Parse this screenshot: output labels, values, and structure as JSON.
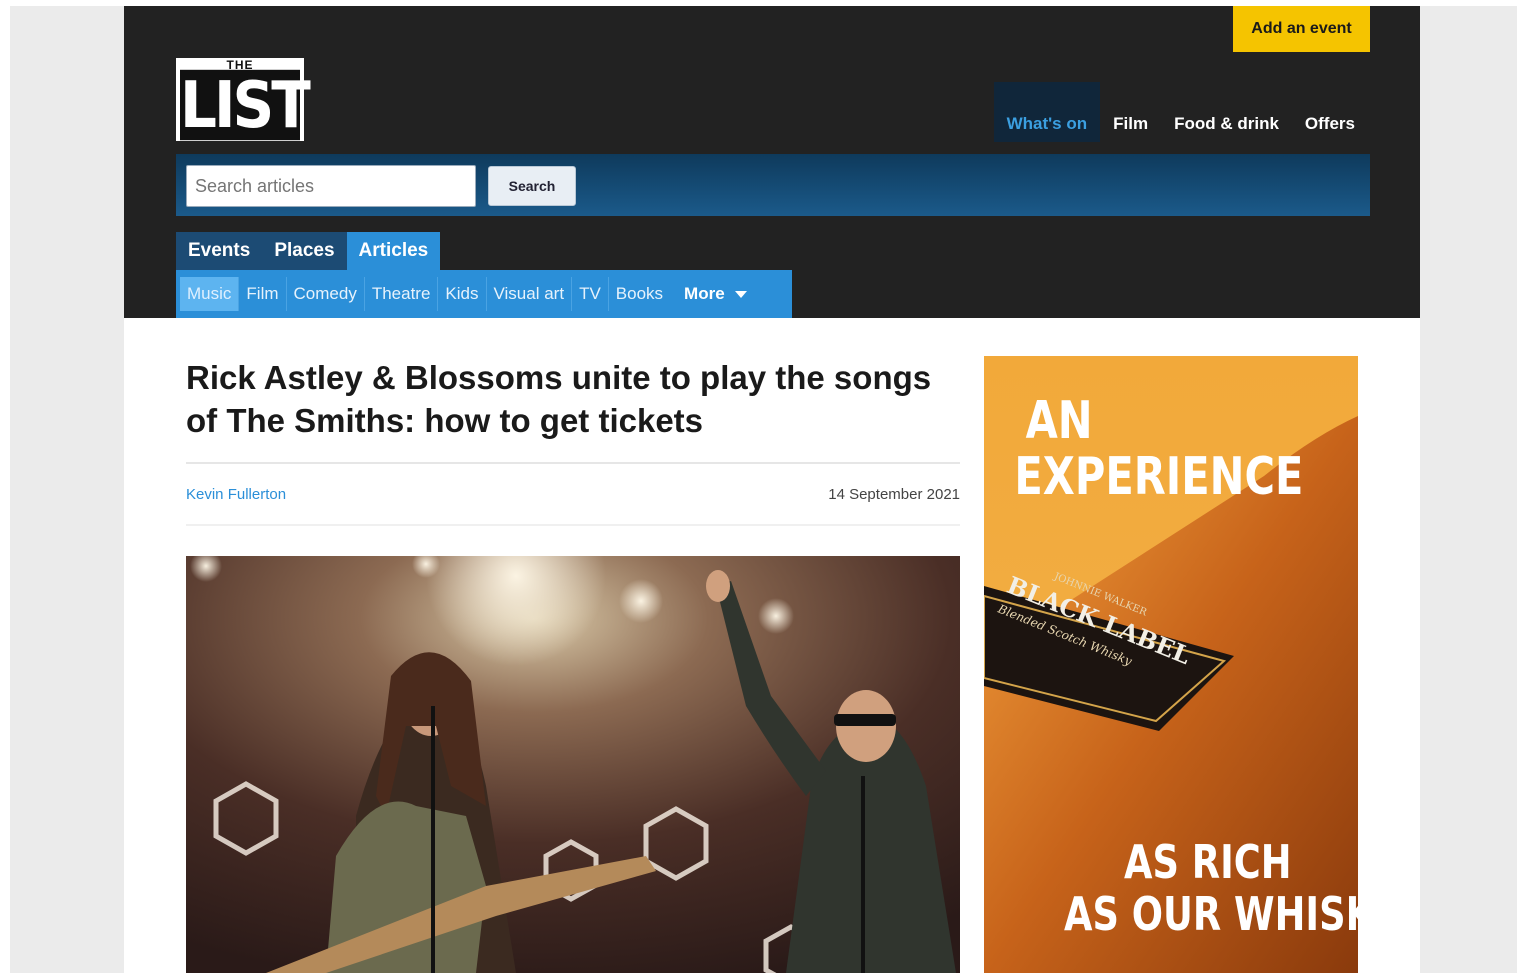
{
  "header": {
    "add_event": "Add an event",
    "logo_top": "THE",
    "logo_main": "LIST",
    "topnav": [
      "What's on",
      "Film",
      "Food & drink",
      "Offers"
    ]
  },
  "search": {
    "placeholder": "Search articles",
    "button": "Search"
  },
  "tabs": [
    "Events",
    "Places",
    "Articles"
  ],
  "subnav": {
    "items": [
      "Music",
      "Film",
      "Comedy",
      "Theatre",
      "Kids",
      "Visual art",
      "TV",
      "Books"
    ],
    "more": "More"
  },
  "article": {
    "headline": "Rick Astley & Blossoms unite to play the songs of The Smiths: how to get tickets",
    "author": "Kevin Fullerton",
    "date": "14 September 2021"
  },
  "ad": {
    "line1": "AN",
    "line2": "EXPERIENCE",
    "label_top": "JOHNNIE WALKER",
    "label_main": "BLACK LABEL",
    "label_sub": "Blended Scotch Whisky",
    "tag1": "AS RICH",
    "tag2": "AS OUR WHISKY"
  },
  "colors": {
    "header_bg": "#222222",
    "accent_blue": "#2b8fd8",
    "add_event_yellow": "#f5c400"
  }
}
